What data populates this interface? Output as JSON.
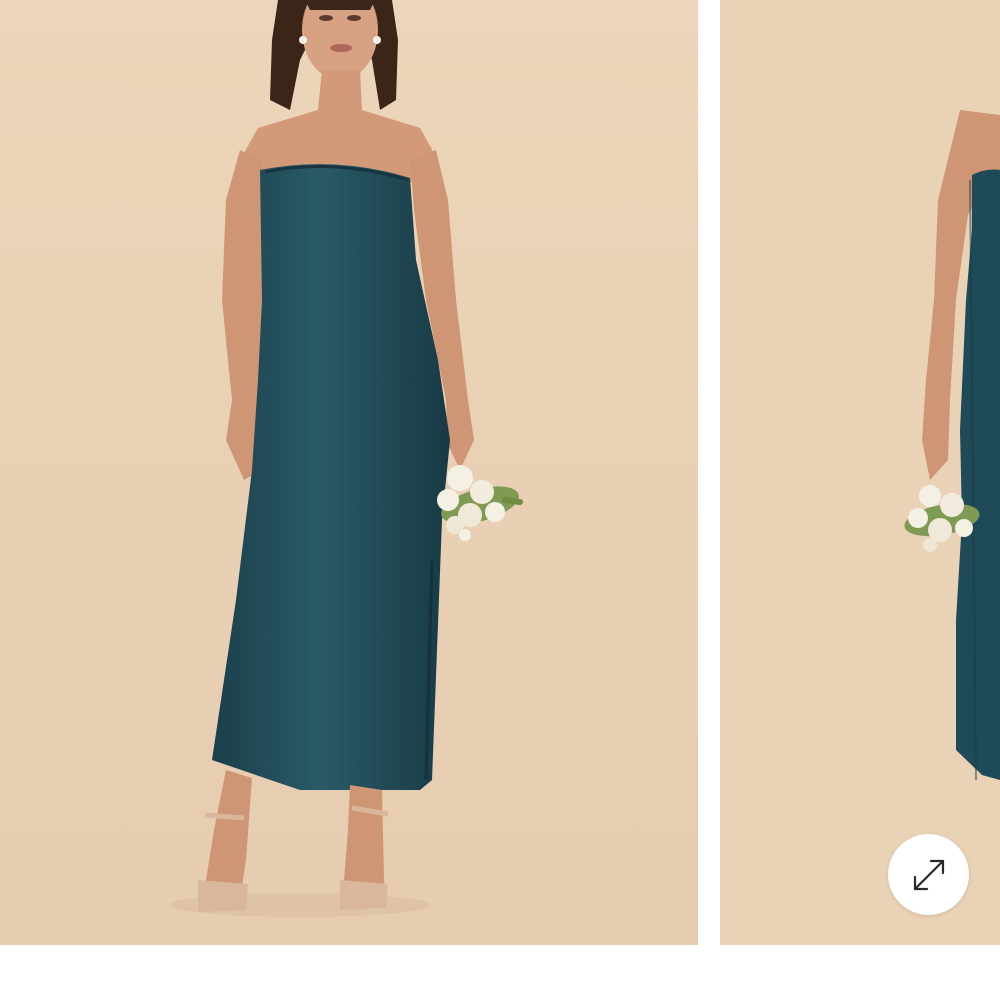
{
  "gallery": {
    "slides": [
      {
        "photo": "model-in-dark-teal-strapless-satin-midi-dress-holding-white-bouquet",
        "background_color": "#ead2b6",
        "dress_color": "#1f4a57"
      },
      {
        "photo": "model-in-dark-teal-strapless-satin-dress-holding-white-bouquet-partial",
        "background_color": "#ead2b6",
        "dress_color": "#1f4a57"
      }
    ],
    "expand_button": {
      "icon": "expand-arrows-icon",
      "aria_label": ""
    }
  },
  "colors": {
    "page_background": "#ffffff",
    "photo_backdrop": "#ead2b6",
    "dress": "#1f4a57",
    "skin": "#d29a78",
    "hair": "#3b2418",
    "flowers": "#f4efe3",
    "leaves": "#7f9a52",
    "sandals": "#d9b79c",
    "icon_stroke": "#2a2a2a"
  }
}
